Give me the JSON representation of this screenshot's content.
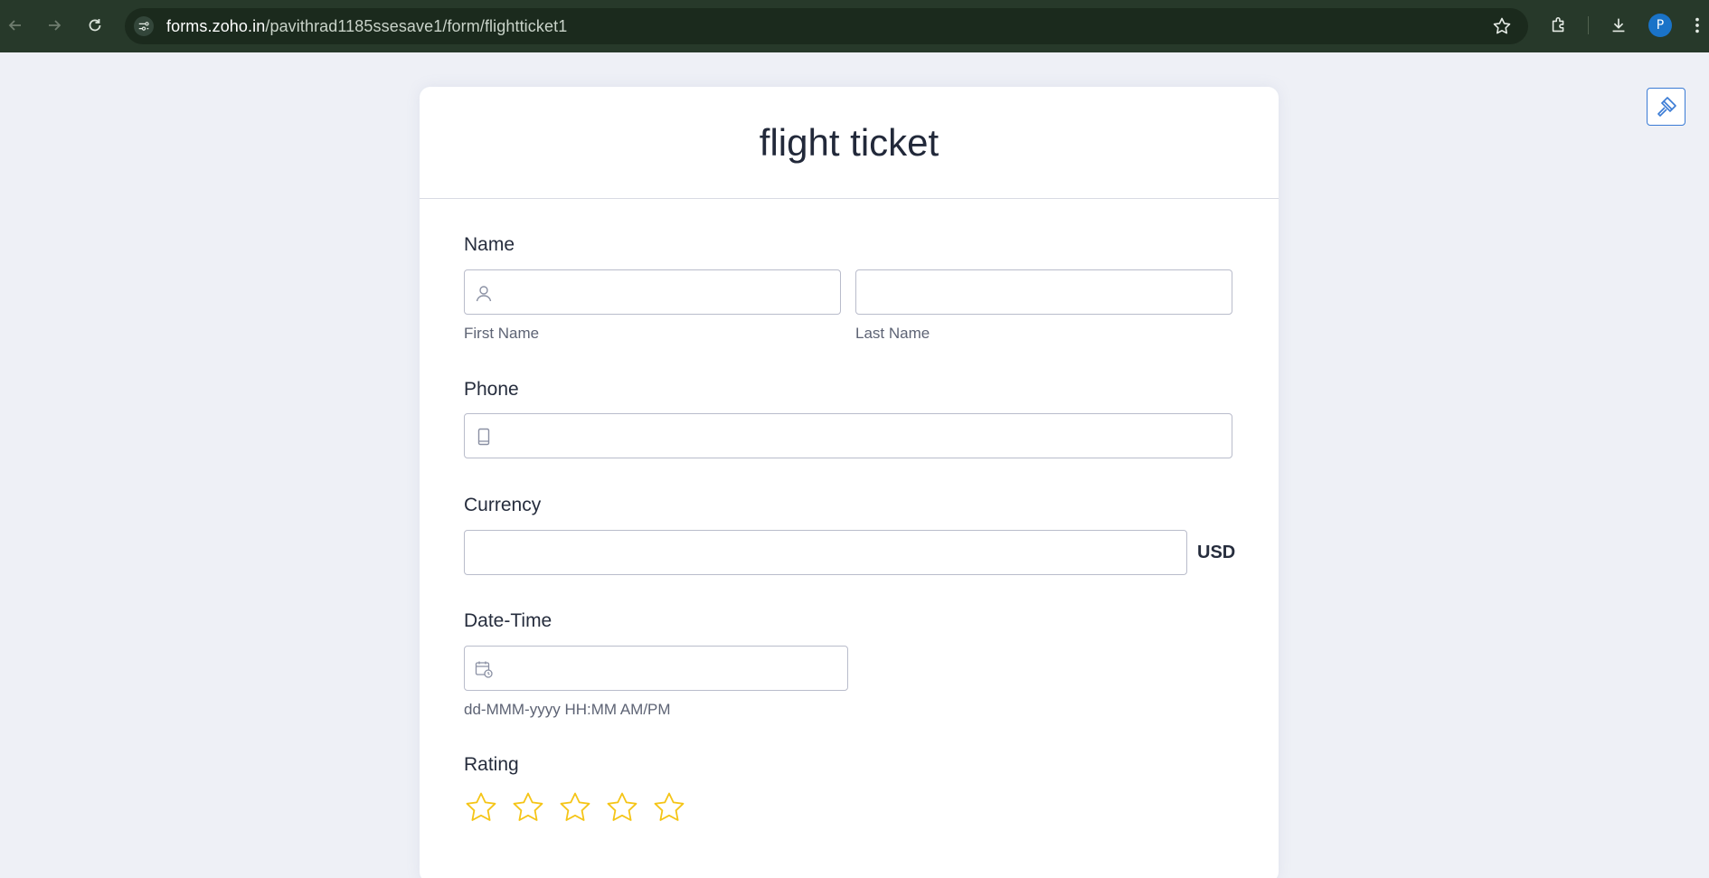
{
  "browser": {
    "url_host": "forms.zoho.in",
    "url_path": "/pavithrad1185ssesave1/form/flightticket1",
    "profile_initial": "P"
  },
  "form": {
    "title": "flight ticket",
    "name": {
      "label": "Name",
      "first_sublabel": "First Name",
      "last_sublabel": "Last Name",
      "first_value": "",
      "last_value": ""
    },
    "phone": {
      "label": "Phone",
      "value": ""
    },
    "currency": {
      "label": "Currency",
      "value": "",
      "unit": "USD"
    },
    "datetime": {
      "label": "Date-Time",
      "value": "",
      "format_hint": "dd-MMM-yyyy HH:MM AM/PM"
    },
    "rating": {
      "label": "Rating",
      "max": 5,
      "value": 0,
      "star_color": "#f5c518"
    }
  },
  "colors": {
    "chrome_bg": "#27392a",
    "page_bg": "#eef0f6",
    "accent": "#3a7bd5"
  }
}
